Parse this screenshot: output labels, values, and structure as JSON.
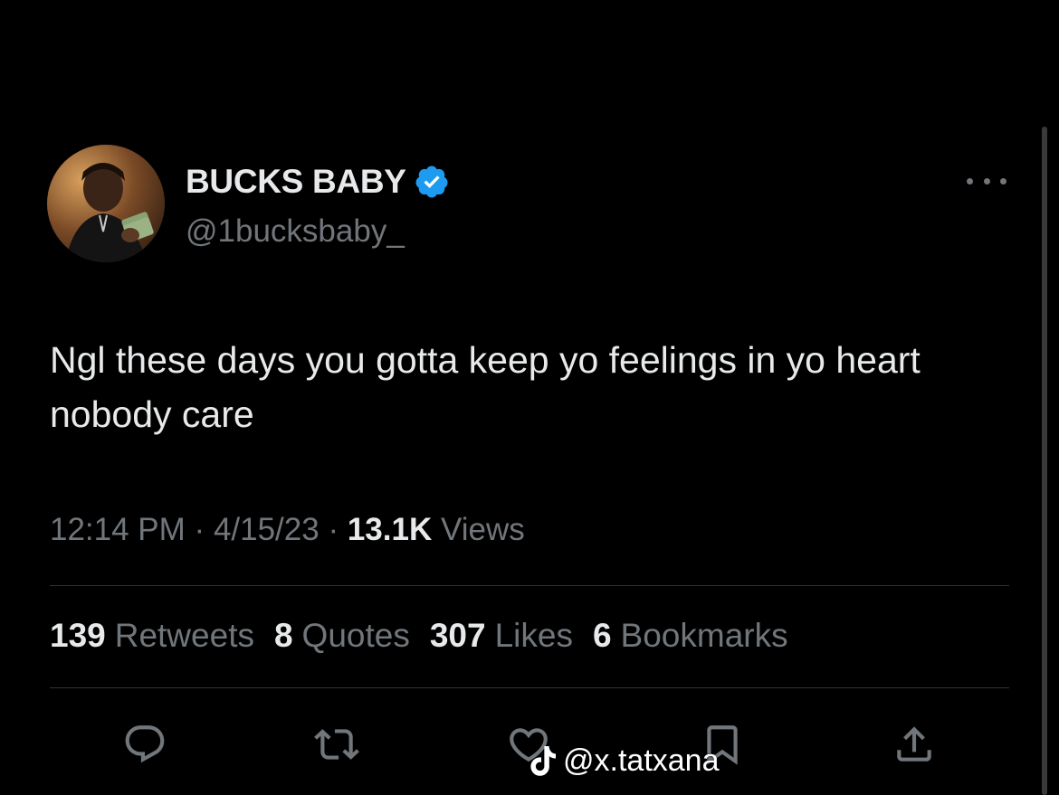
{
  "tweet": {
    "display_name": "BUCKS BABY",
    "handle": "@1bucksbaby_",
    "text": "Ngl these days you gotta keep yo feelings in yo heart nobody care",
    "time": "12:14 PM",
    "date": "4/15/23",
    "separator": "·",
    "views_count": "13.1K",
    "views_label": "Views"
  },
  "stats": {
    "retweets": {
      "count": "139",
      "label": "Retweets"
    },
    "quotes": {
      "count": "8",
      "label": "Quotes"
    },
    "likes": {
      "count": "307",
      "label": "Likes"
    },
    "bookmarks": {
      "count": "6",
      "label": "Bookmarks"
    }
  },
  "actions": {
    "reply_icon": "reply-icon",
    "retweet_icon": "retweet-icon",
    "like_icon": "heart-icon",
    "bookmark_icon": "bookmark-icon",
    "share_icon": "share-icon"
  },
  "watermark": {
    "text": "@x.tatxana"
  },
  "colors": {
    "background": "#000000",
    "primary_text": "#e7e9ea",
    "secondary_text": "#71767b",
    "verified_blue": "#1d9bf0",
    "divider": "#2f3336"
  }
}
